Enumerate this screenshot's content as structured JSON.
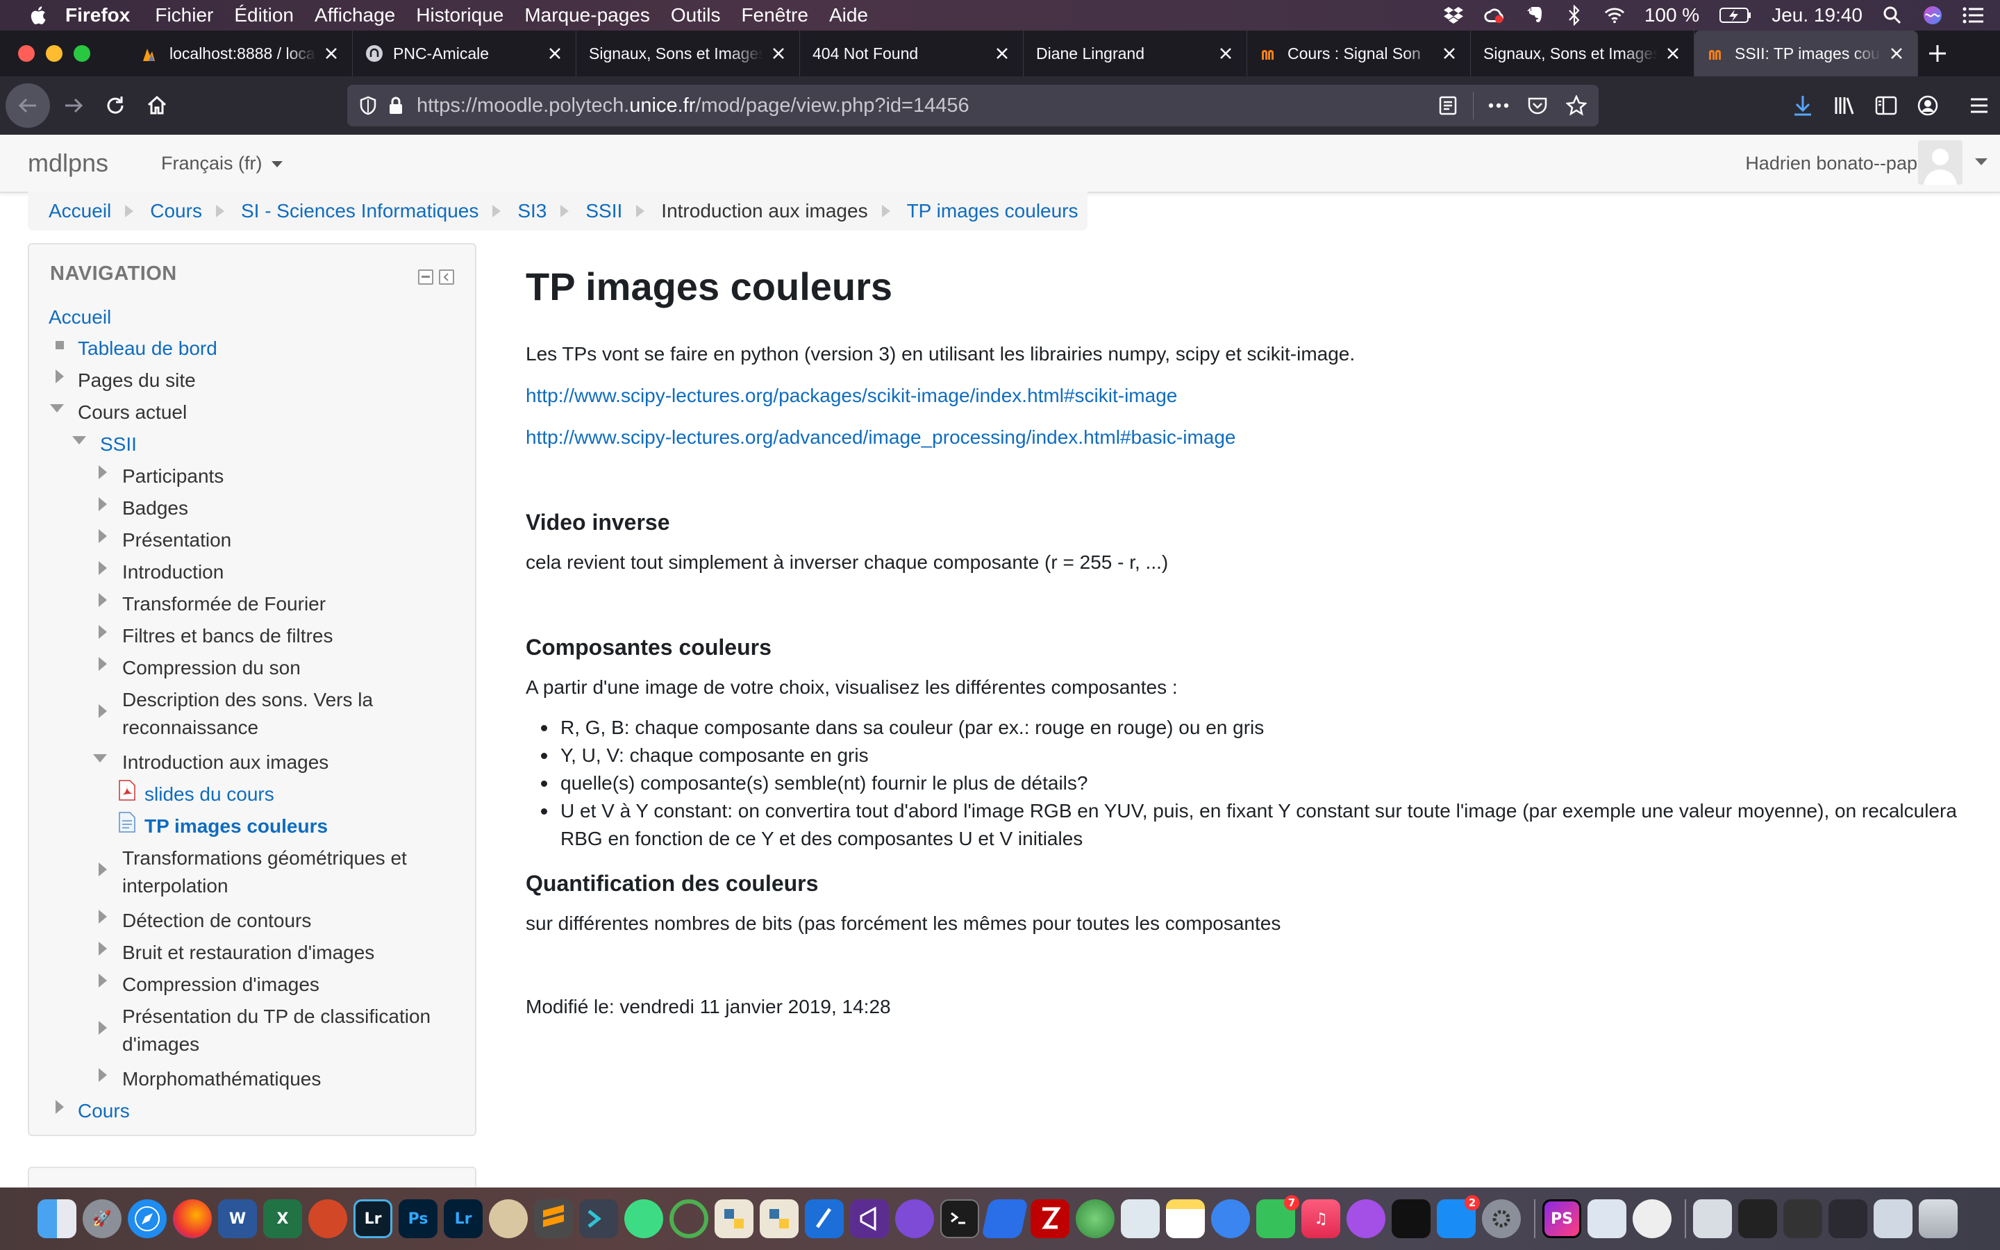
{
  "menubar": {
    "app": "Firefox",
    "menus": [
      "Fichier",
      "Édition",
      "Affichage",
      "Historique",
      "Marque-pages",
      "Outils",
      "Fenêtre",
      "Aide"
    ],
    "battery": "100 %",
    "clock": "Jeu. 19:40"
  },
  "tabs": [
    {
      "title": "localhost:8888 / localhost",
      "active": false
    },
    {
      "title": "PNC-Amicale",
      "active": false
    },
    {
      "title": "Signaux, Sons et Images",
      "active": false
    },
    {
      "title": "404 Not Found",
      "active": false
    },
    {
      "title": "Diane Lingrand",
      "active": false
    },
    {
      "title": "Cours : Signal Son",
      "active": false
    },
    {
      "title": "Signaux, Sons et Images",
      "active": false
    },
    {
      "title": "SSII: TP images couleurs",
      "active": true
    }
  ],
  "urlbar": {
    "prefix": "https://moodle.polytech.",
    "domain": "unice.fr",
    "path": "/mod/page/view.php?id=14456"
  },
  "header": {
    "brand": "mdlpns",
    "language": "Français (fr)",
    "user": "Hadrien bonato--pape"
  },
  "breadcrumb": [
    {
      "label": "Accueil",
      "link": true
    },
    {
      "label": "Cours",
      "link": true
    },
    {
      "label": "SI - Sciences Informatiques",
      "link": true
    },
    {
      "label": "SI3",
      "link": true
    },
    {
      "label": "SSII",
      "link": true
    },
    {
      "label": "Introduction aux images",
      "link": false
    },
    {
      "label": "TP images couleurs",
      "link": true
    }
  ],
  "navigation": {
    "title": "NAVIGATION",
    "items": [
      {
        "label": "Accueil"
      },
      {
        "label": "Tableau de bord"
      },
      {
        "label": "Pages du site"
      },
      {
        "label": "Cours actuel"
      },
      {
        "label": "SSII"
      },
      {
        "label": "Participants"
      },
      {
        "label": "Badges"
      },
      {
        "label": "Présentation"
      },
      {
        "label": "Introduction"
      },
      {
        "label": "Transformée de Fourier"
      },
      {
        "label": "Filtres et bancs de filtres"
      },
      {
        "label": "Compression du son"
      },
      {
        "label": "Description des sons. Vers la",
        "label2": "reconnaissance"
      },
      {
        "label": "Introduction aux images"
      },
      {
        "label": "slides du cours"
      },
      {
        "label": "TP images couleurs"
      },
      {
        "label": "Transformations géométriques et",
        "label2": "interpolation"
      },
      {
        "label": "Détection de contours"
      },
      {
        "label": "Bruit et restauration d'images"
      },
      {
        "label": "Compression d'images"
      },
      {
        "label": "Présentation du TP de classification",
        "label2": "d'images"
      },
      {
        "label": "Morphomathématiques"
      },
      {
        "label": "Cours"
      }
    ]
  },
  "main": {
    "title": "TP images couleurs",
    "intro": "Les TPs vont se faire en python (version 3) en utilisant les librairies numpy, scipy et scikit-image.",
    "link1": "http://www.scipy-lectures.org/packages/scikit-image/index.html#scikit-image",
    "link2": "http://www.scipy-lectures.org/advanced/image_processing/index.html#basic-image",
    "s1_title": "Video inverse",
    "s1_text": "cela revient tout simplement à inverser chaque composante (r = 255 - r, ...)",
    "s2_title": "Composantes couleurs",
    "s2_text": "A partir d'une image de votre choix, visualisez les différentes composantes :",
    "s2_items": [
      "R, G, B: chaque composante dans sa couleur (par ex.: rouge en rouge) ou en gris",
      "Y, U, V: chaque composante en gris",
      "quelle(s) composante(s) semble(nt) fournir le plus de détails?",
      "U et V à Y constant: on convertira tout d'abord l'image RGB en YUV, puis, en fixant Y constant sur toute l'image (par exemple une valeur moyenne), on recalculera RBG en fonction de ce Y et des composantes U et V initiales"
    ],
    "s3_title": "Quantification des couleurs",
    "s3_text": "sur différentes nombres de bits (pas forcément les mêmes pour toutes les composantes",
    "modified": "Modifié le: vendredi 11 janvier 2019, 14:28"
  },
  "dock": {
    "apps": [
      "Finder",
      "Launchpad",
      "Safari",
      "Firefox",
      "Word",
      "Excel",
      "PowerPoint",
      "Lightroom Classic",
      "Photoshop",
      "Lightroom",
      "Cyberduck",
      "Sublime Text",
      "Prompt",
      "Android Studio",
      "Circle",
      "Python Launcher",
      "Python",
      "Xcode",
      "Visual Studio",
      "GitHub Desktop",
      "Terminal",
      "Flow",
      "FileZilla",
      "Globe",
      "Preview",
      "Notes",
      "Messages",
      "FaceTime",
      "Music",
      "Podcasts",
      "Apple TV",
      "App Store",
      "System Preferences",
      "PhpStorm",
      "Mail",
      "Agent",
      "Finder Window",
      "Terminal Window",
      "Screenshot",
      "Window",
      "Trash"
    ],
    "labels": {
      "word": "W",
      "excel": "X",
      "lr": "Lr",
      "ps": "Ps",
      "lr2": "Lr",
      "phpstorm": "PS"
    },
    "badges": {
      "facetime": "7",
      "appstore": "2"
    }
  }
}
